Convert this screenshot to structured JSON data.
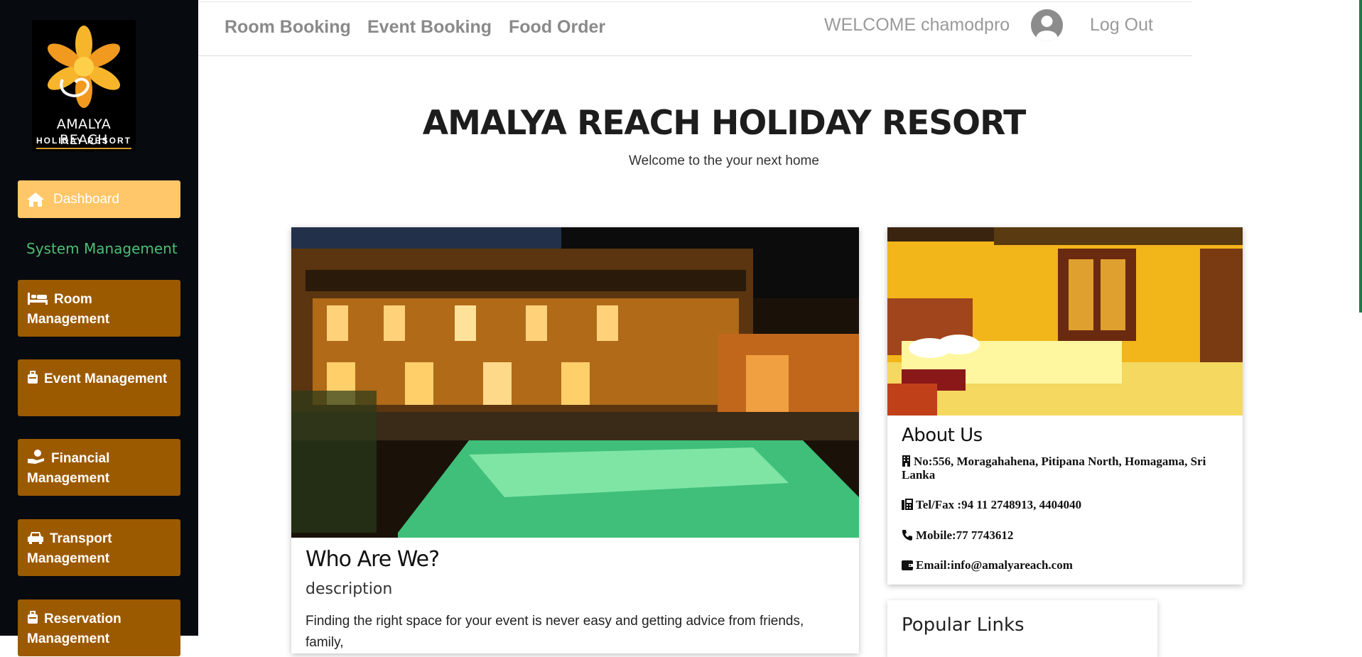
{
  "sidebar": {
    "logo": {
      "brand_line1": "AMALYA REACH",
      "brand_line2": "HOLIDAY RESORT"
    },
    "dashboard_label": "Dashboard",
    "section_title": "System Management",
    "items": [
      {
        "label": "Room Management",
        "icon": "bed-icon"
      },
      {
        "label": "Event Management",
        "icon": "suitcase-icon"
      },
      {
        "label": "Financial Management",
        "icon": "hand-holding-dollar-icon"
      },
      {
        "label": "Transport Management",
        "icon": "car-icon"
      },
      {
        "label": "Reservation Management",
        "icon": "suitcase-icon"
      }
    ]
  },
  "topbar": {
    "nav": [
      "Room Booking",
      "Event Booking",
      "Food Order"
    ],
    "welcome": "WELCOME chamodpro",
    "logout": "Log Out"
  },
  "hero": {
    "title": "AMALYA REACH HOLIDAY RESORT",
    "subtitle": "Welcome to the your next home"
  },
  "main_card": {
    "heading": "Who Are We?",
    "description": "description",
    "paragraph": "Finding the right space for your event is never easy and getting advice from friends, family,"
  },
  "about": {
    "heading": "About Us",
    "address": "No:556, Moragahahena, Pitipana North, Homagama, Sri Lanka",
    "tel": "Tel/Fax :94 11 2748913, 4404040",
    "mobile": "Mobile:77 7743612",
    "email": "Email:info@amalyareach.com"
  },
  "popular": {
    "heading": "Popular Links"
  },
  "colors": {
    "dashboard": "#ffc769",
    "nav_item": "#9c5a00",
    "section_title": "#4dbd74",
    "sidebar_bg": "#070a0f"
  }
}
